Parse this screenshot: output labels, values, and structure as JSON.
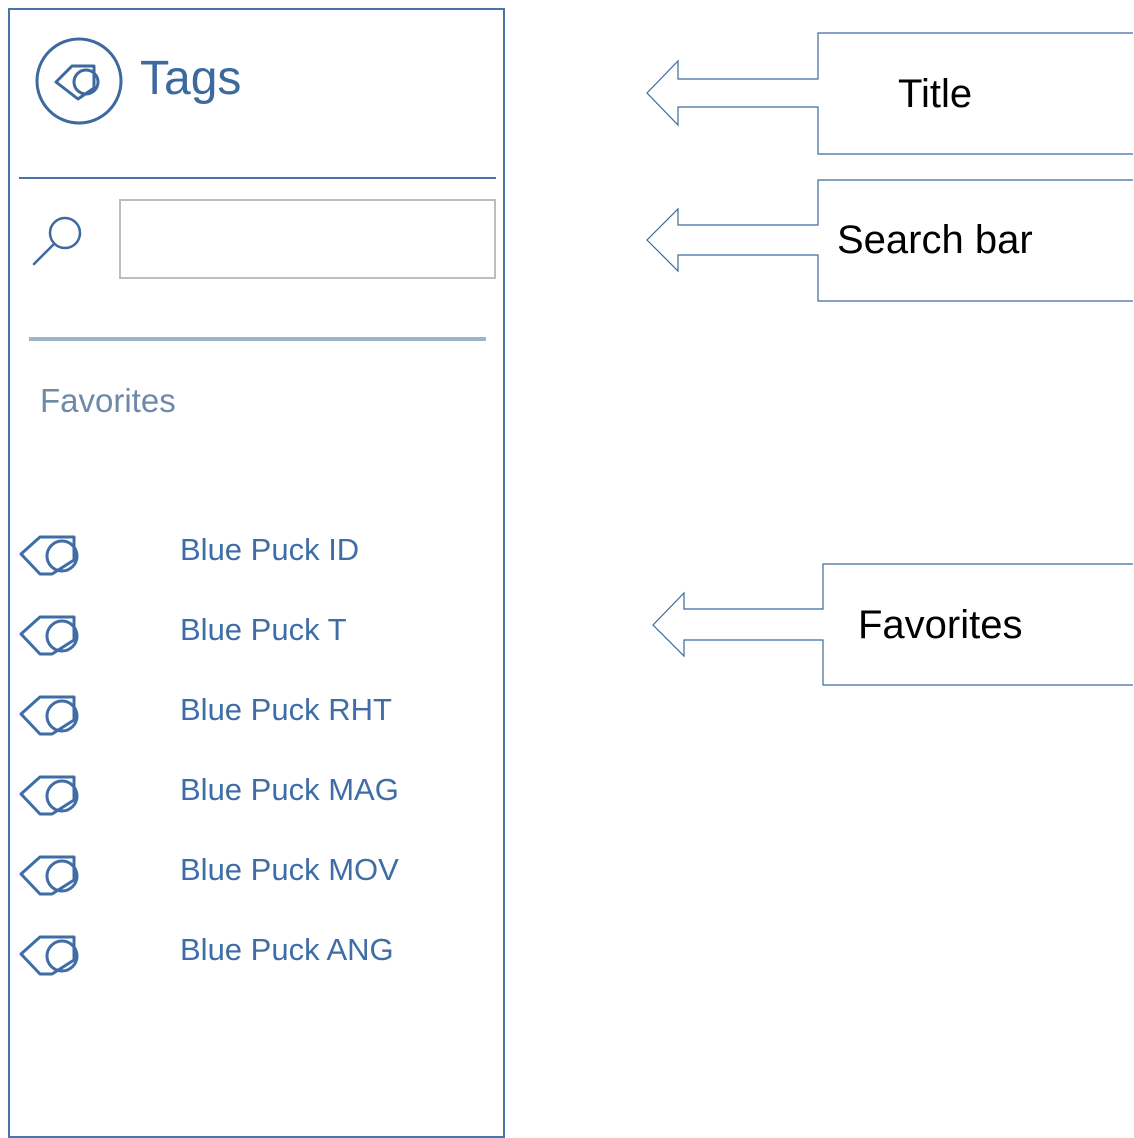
{
  "panel": {
    "title": "Tags",
    "title_icon": "tag-circle-icon",
    "search": {
      "icon": "search-icon",
      "value": "",
      "placeholder": ""
    },
    "favorites_heading": "Favorites",
    "favorites": [
      {
        "label": "Blue Puck ID",
        "icon": "tag-icon"
      },
      {
        "label": "Blue Puck T",
        "icon": "tag-icon"
      },
      {
        "label": "Blue Puck RHT",
        "icon": "tag-icon"
      },
      {
        "label": "Blue Puck MAG",
        "icon": "tag-icon"
      },
      {
        "label": "Blue Puck MOV",
        "icon": "tag-icon"
      },
      {
        "label": "Blue Puck ANG",
        "icon": "tag-icon"
      }
    ]
  },
  "callouts": [
    {
      "label": "Title",
      "icon": "arrow-left-icon"
    },
    {
      "label": "Search bar",
      "icon": "arrow-left-icon"
    },
    {
      "label": "Favorites",
      "icon": "arrow-left-icon"
    }
  ],
  "colors": {
    "accent": "#3f6da6",
    "border": "#4a74a9",
    "muted": "#6f8aa8"
  }
}
